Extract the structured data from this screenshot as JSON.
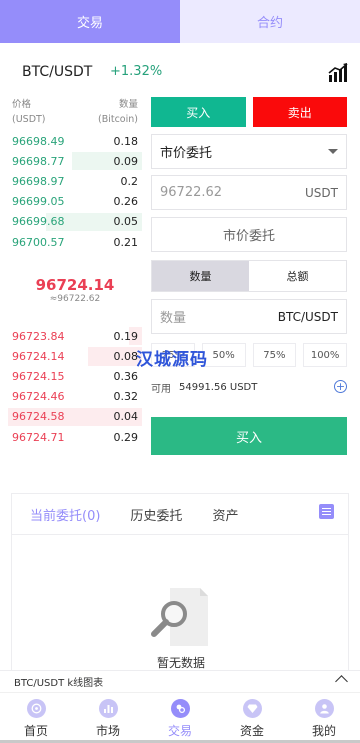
{
  "top_tabs": {
    "trade": "交易",
    "contract": "合约"
  },
  "pair": {
    "name": "BTC/USDT",
    "change": "+1.32%"
  },
  "orderbook": {
    "price_label": "价格",
    "price_unit": "(USDT)",
    "qty_label": "数量",
    "qty_unit": "(Bitcoin)",
    "bids": [
      {
        "price": "96698.49",
        "qty": "0.18",
        "depth": 0.0
      },
      {
        "price": "96698.77",
        "qty": "0.09",
        "depth": 0.52
      },
      {
        "price": "96698.97",
        "qty": "0.2",
        "depth": 0.0
      },
      {
        "price": "96699.05",
        "qty": "0.26",
        "depth": 0.0
      },
      {
        "price": "96699.68",
        "qty": "0.05",
        "depth": 0.72
      },
      {
        "price": "96700.57",
        "qty": "0.21",
        "depth": 0.0
      }
    ],
    "last_price": "96724.14",
    "last_price_ref": "≈96722.62",
    "asks": [
      {
        "price": "96723.84",
        "qty": "0.19",
        "depth": 0.1
      },
      {
        "price": "96724.14",
        "qty": "0.08",
        "depth": 0.4
      },
      {
        "price": "96724.15",
        "qty": "0.36",
        "depth": 0.0
      },
      {
        "price": "96724.46",
        "qty": "0.32",
        "depth": 0.0
      },
      {
        "price": "96724.58",
        "qty": "0.04",
        "depth": 1.0
      },
      {
        "price": "96724.71",
        "qty": "0.29",
        "depth": 0.0
      }
    ]
  },
  "form": {
    "buy_tab": "买入",
    "sell_tab": "卖出",
    "order_type": "市价委托",
    "price_value": "96722.62",
    "price_unit": "USDT",
    "market_label": "市价委托",
    "amount_tab": "数量",
    "total_tab": "总额",
    "qty_placeholder": "数量",
    "qty_unit": "BTC/USDT",
    "percents": [
      "25%",
      "50%",
      "75%",
      "100%"
    ],
    "available_label": "可用",
    "available_value": "54991.56 USDT",
    "buy_button": "买入"
  },
  "watermark": "汉城源码",
  "orders": {
    "tabs": [
      "当前委托(0)",
      "历史委托",
      "资产"
    ],
    "empty_text": "暂无数据"
  },
  "kline_label": "BTC/USDT k线图表",
  "nav": [
    {
      "label": "首页",
      "icon": "compass-icon"
    },
    {
      "label": "市场",
      "icon": "bar-chart-icon"
    },
    {
      "label": "交易",
      "icon": "exchange-icon"
    },
    {
      "label": "资金",
      "icon": "diamond-icon"
    },
    {
      "label": "我的",
      "icon": "user-icon"
    }
  ],
  "colors": {
    "accent": "#958dfa",
    "buy": "#10b791",
    "sell": "#fa0a0b",
    "bid_text": "#2aa47a",
    "ask_text": "#ea3f54"
  }
}
